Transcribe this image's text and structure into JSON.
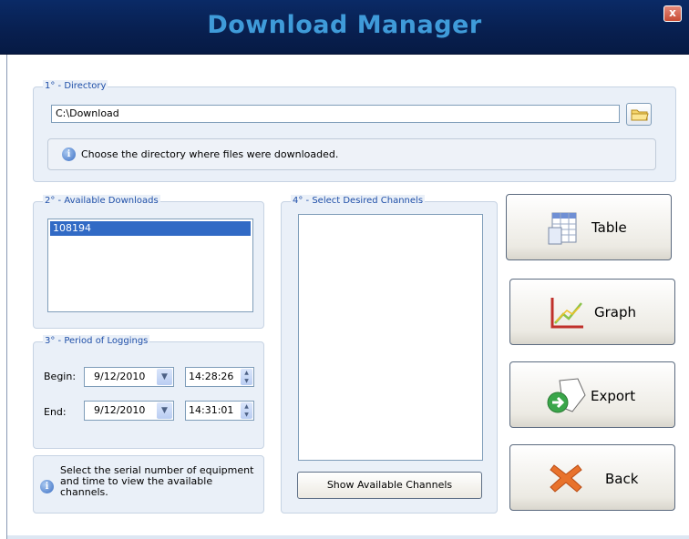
{
  "window": {
    "title": "Download Manager",
    "close_label": "x"
  },
  "directory": {
    "legend": "1° - Directory",
    "path_value": "C:\\Download",
    "info": "Choose the directory where files were downloaded."
  },
  "downloads": {
    "legend": "2° - Available Downloads",
    "items": [
      "108194"
    ]
  },
  "period": {
    "legend": "3° - Period of Loggings",
    "begin_label": "Begin:",
    "begin_date": "9/12/2010",
    "begin_time": "14:28:26",
    "end_label": "End:",
    "end_date": "9/12/2010",
    "end_time": "14:31:01"
  },
  "hint": {
    "text": "Select the serial number of equipment and time to view the available channels."
  },
  "channels": {
    "legend": "4° - Select Desired Channels",
    "show_button": "Show Available Channels"
  },
  "actions": {
    "table": "Table",
    "graph": "Graph",
    "export": "Export",
    "back": "Back"
  },
  "colors": {
    "titlebar": "#0a2a66",
    "title_text": "#3f9bd9",
    "legend_text": "#1f4fa8",
    "selection": "#316ac5",
    "group_bg": "#eaf0f8"
  }
}
